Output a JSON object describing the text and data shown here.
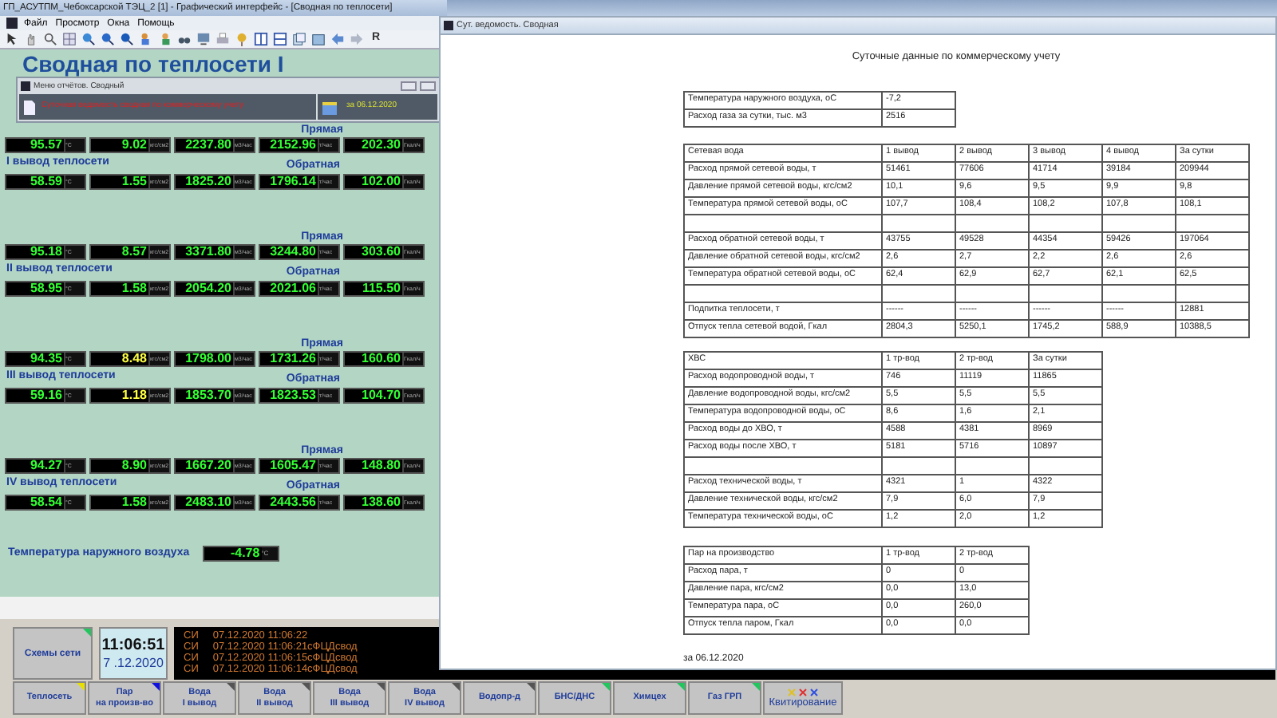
{
  "app_window": {
    "title": "ГП_АСУТПМ_Чебоксарской ТЭЦ_2 [1] - Графический интерфейс - [Сводная по теплосети]",
    "menu": [
      "Файл",
      "Просмотр",
      "Окна",
      "Помощь"
    ],
    "toolbar_button": "R"
  },
  "panel": {
    "heading": "Сводная по теплосети I",
    "outputs": [
      {
        "name": "I вывод теплосети",
        "supply_label": "Прямая",
        "return_label": "Обратная",
        "supply": [
          {
            "value": "95.57",
            "unit": "°C",
            "alarm": false
          },
          {
            "value": "9.02",
            "unit": "кгс/см2",
            "alarm": false
          },
          {
            "value": "2237.80",
            "unit": "м3/час",
            "alarm": false
          },
          {
            "value": "2152.96",
            "unit": "т/час",
            "alarm": false
          },
          {
            "value": "202.30",
            "unit": "Гкал/ч",
            "alarm": false
          }
        ],
        "return": [
          {
            "value": "58.59",
            "unit": "°C",
            "alarm": false
          },
          {
            "value": "1.55",
            "unit": "кгс/см2",
            "alarm": false
          },
          {
            "value": "1825.20",
            "unit": "м3/час",
            "alarm": false
          },
          {
            "value": "1796.14",
            "unit": "т/час",
            "alarm": false
          },
          {
            "value": "102.00",
            "unit": "Гкал/ч",
            "alarm": false
          }
        ]
      },
      {
        "name": "II вывод теплосети",
        "supply_label": "Прямая",
        "return_label": "Обратная",
        "supply": [
          {
            "value": "95.18",
            "unit": "°C",
            "alarm": false
          },
          {
            "value": "8.57",
            "unit": "кгс/см2",
            "alarm": false
          },
          {
            "value": "3371.80",
            "unit": "м3/час",
            "alarm": false
          },
          {
            "value": "3244.80",
            "unit": "т/час",
            "alarm": false
          },
          {
            "value": "303.60",
            "unit": "Гкал/ч",
            "alarm": false
          }
        ],
        "return": [
          {
            "value": "58.95",
            "unit": "°C",
            "alarm": false
          },
          {
            "value": "1.58",
            "unit": "кгс/см2",
            "alarm": false
          },
          {
            "value": "2054.20",
            "unit": "м3/час",
            "alarm": false
          },
          {
            "value": "2021.06",
            "unit": "т/час",
            "alarm": false
          },
          {
            "value": "115.50",
            "unit": "Гкал/ч",
            "alarm": false
          }
        ]
      },
      {
        "name": "III вывод теплосети",
        "supply_label": "Прямая",
        "return_label": "Обратная",
        "supply": [
          {
            "value": "94.35",
            "unit": "°C",
            "alarm": false
          },
          {
            "value": "8.48",
            "unit": "кгс/см2",
            "alarm": true
          },
          {
            "value": "1798.00",
            "unit": "м3/час",
            "alarm": false
          },
          {
            "value": "1731.26",
            "unit": "т/час",
            "alarm": false
          },
          {
            "value": "160.60",
            "unit": "Гкал/ч",
            "alarm": false
          }
        ],
        "return": [
          {
            "value": "59.16",
            "unit": "°C",
            "alarm": false
          },
          {
            "value": "1.18",
            "unit": "кгс/см2",
            "alarm": true
          },
          {
            "value": "1853.70",
            "unit": "м3/час",
            "alarm": false
          },
          {
            "value": "1823.53",
            "unit": "т/час",
            "alarm": false
          },
          {
            "value": "104.70",
            "unit": "Гкал/ч",
            "alarm": false
          }
        ]
      },
      {
        "name": "IV вывод теплосети",
        "supply_label": "Прямая",
        "return_label": "Обратная",
        "supply": [
          {
            "value": "94.27",
            "unit": "°C",
            "alarm": false
          },
          {
            "value": "8.90",
            "unit": "кгс/см2",
            "alarm": false
          },
          {
            "value": "1667.20",
            "unit": "м3/час",
            "alarm": false
          },
          {
            "value": "1605.47",
            "unit": "т/час",
            "alarm": false
          },
          {
            "value": "148.80",
            "unit": "Гкал/ч",
            "alarm": false
          }
        ],
        "return": [
          {
            "value": "58.54",
            "unit": "°C",
            "alarm": false
          },
          {
            "value": "1.58",
            "unit": "кгс/см2",
            "alarm": false
          },
          {
            "value": "2483.10",
            "unit": "м3/час",
            "alarm": false
          },
          {
            "value": "2443.56",
            "unit": "т/час",
            "alarm": false
          },
          {
            "value": "138.60",
            "unit": "Гкал/ч",
            "alarm": false
          }
        ]
      }
    ],
    "outdoor": {
      "label": "Температура наружного воздуха",
      "value": "-4.78",
      "unit": "°C"
    }
  },
  "reports_menu": {
    "title": "Меню отчётов. Сводный",
    "report": "Суточная ведомость сводная по коммерческому учету",
    "date": "за 06.12.2020"
  },
  "report_window": {
    "title": "Сут. ведомость. Сводная",
    "heading": "Суточные данные по коммерческому учету",
    "tables": [
      {
        "rows": [
          {
            "kind": "data",
            "cells": [
              "Температура наружного воздуха, оС",
              "-7,2"
            ]
          },
          {
            "kind": "data",
            "cells": [
              "Расход газа за сутки, тыс. м3",
              "2516"
            ]
          }
        ]
      },
      {
        "rows": [
          {
            "kind": "data",
            "cells": [
              "Сетевая вода",
              "1 вывод",
              "2 вывод",
              "3 вывод",
              "4 вывод",
              "За сутки"
            ]
          },
          {
            "kind": "data",
            "cells": [
              "Расход прямой сетевой воды, т",
              "51461",
              "77606",
              "41714",
              "39184",
              "209944"
            ]
          },
          {
            "kind": "data",
            "cells": [
              "Давление прямой сетевой воды, кгс/см2",
              "10,1",
              "9,6",
              "9,5",
              "9,9",
              "9,8"
            ]
          },
          {
            "kind": "data",
            "cells": [
              "Температура прямой сетевой воды, оС",
              "107,7",
              "108,4",
              "108,2",
              "107,8",
              "108,1"
            ]
          },
          {
            "kind": "blank"
          },
          {
            "kind": "data",
            "cells": [
              "Расход обратной сетевой воды, т",
              "43755",
              "49528",
              "44354",
              "59426",
              "197064"
            ]
          },
          {
            "kind": "data",
            "cells": [
              "Давление обратной сетевой воды, кгс/см2",
              "2,6",
              "2,7",
              "2,2",
              "2,6",
              "2,6"
            ]
          },
          {
            "kind": "data",
            "cells": [
              "Температура обратной сетевой воды, оС",
              "62,4",
              "62,9",
              "62,7",
              "62,1",
              "62,5"
            ]
          },
          {
            "kind": "blank"
          },
          {
            "kind": "data",
            "cells": [
              "Подпитка теплосети, т",
              "------",
              "------",
              "------",
              "------",
              "12881"
            ]
          },
          {
            "kind": "data",
            "cells": [
              "Отпуск тепла сетевой водой, Гкал",
              "2804,3",
              "5250,1",
              "1745,2",
              "588,9",
              "10388,5"
            ]
          }
        ]
      },
      {
        "rows": [
          {
            "kind": "data",
            "cells": [
              "ХВС",
              "1 тр-вод",
              "2 тр-вод",
              "За сутки"
            ]
          },
          {
            "kind": "data",
            "cells": [
              "Расход водопроводной воды, т",
              "746",
              "11119",
              "11865"
            ]
          },
          {
            "kind": "data",
            "cells": [
              "Давление водопроводной воды, кгс/см2",
              "5,5",
              "5,5",
              "5,5"
            ]
          },
          {
            "kind": "data",
            "cells": [
              "Температура водопроводной воды, оС",
              "8,6",
              "1,6",
              "2,1"
            ]
          },
          {
            "kind": "data",
            "cells": [
              "Расход воды до ХВО, т",
              "4588",
              "4381",
              "8969"
            ]
          },
          {
            "kind": "data",
            "cells": [
              "Расход воды после ХВО, т",
              "5181",
              "5716",
              "10897"
            ]
          },
          {
            "kind": "blank"
          },
          {
            "kind": "data",
            "cells": [
              "Расход технической воды, т",
              "4321",
              "1",
              "4322"
            ]
          },
          {
            "kind": "data",
            "cells": [
              "Давление технической воды, кгс/см2",
              "7,9",
              "6,0",
              "7,9"
            ]
          },
          {
            "kind": "data",
            "cells": [
              "Температура технической воды, оС",
              "1,2",
              "2,0",
              "1,2"
            ]
          }
        ]
      },
      {
        "rows": [
          {
            "kind": "data",
            "cells": [
              "Пар на производство",
              "1 тр-вод",
              "2 тр-вод"
            ]
          },
          {
            "kind": "data",
            "cells": [
              "Расход пара, т",
              "0",
              "0"
            ]
          },
          {
            "kind": "data",
            "cells": [
              "Давление пара, кгс/см2",
              "0,0",
              "13,0"
            ]
          },
          {
            "kind": "data",
            "cells": [
              "Температура пара, оС",
              "0,0",
              "260,0"
            ]
          },
          {
            "kind": "data",
            "cells": [
              "Отпуск тепла паром, Гкал",
              "0,0",
              "0,0"
            ]
          }
        ]
      }
    ],
    "footer": "за 06.12.2020"
  },
  "bottom": {
    "schemes_button": {
      "label": "Схемы сети",
      "color": "#22c55e"
    },
    "clock": {
      "time": "11:06:51",
      "date": "7 .12.2020"
    },
    "messages": [
      "СИ     07.12.2020 11:06:22",
      "СИ     07.12.2020 11:06:21сФЦДсвод",
      "СИ     07.12.2020 11:06:15сФЦДсвод",
      "СИ     07.12.2020 11:06:14сФЦДсвод"
    ],
    "tabs": [
      {
        "label": "Теплосеть",
        "color": "#e8e000"
      },
      {
        "label": "Пар\nна произв-во",
        "color": "#1010e0"
      },
      {
        "label": "Вода\nI вывод",
        "color": "#555555"
      },
      {
        "label": "Вода\nII вывод",
        "color": "#555555"
      },
      {
        "label": "Вода\nIII вывод",
        "color": "#555555"
      },
      {
        "label": "Вода\nIV вывод",
        "color": "#555555"
      },
      {
        "label": "Водопр-д",
        "color": "#555555"
      },
      {
        "label": "БНС/ДНС",
        "color": "#22c55e"
      },
      {
        "label": "Химцех",
        "color": "#22c55e"
      },
      {
        "label": "Газ ГРП",
        "color": "#22c55e"
      }
    ],
    "ack_button": "Квитирование"
  }
}
